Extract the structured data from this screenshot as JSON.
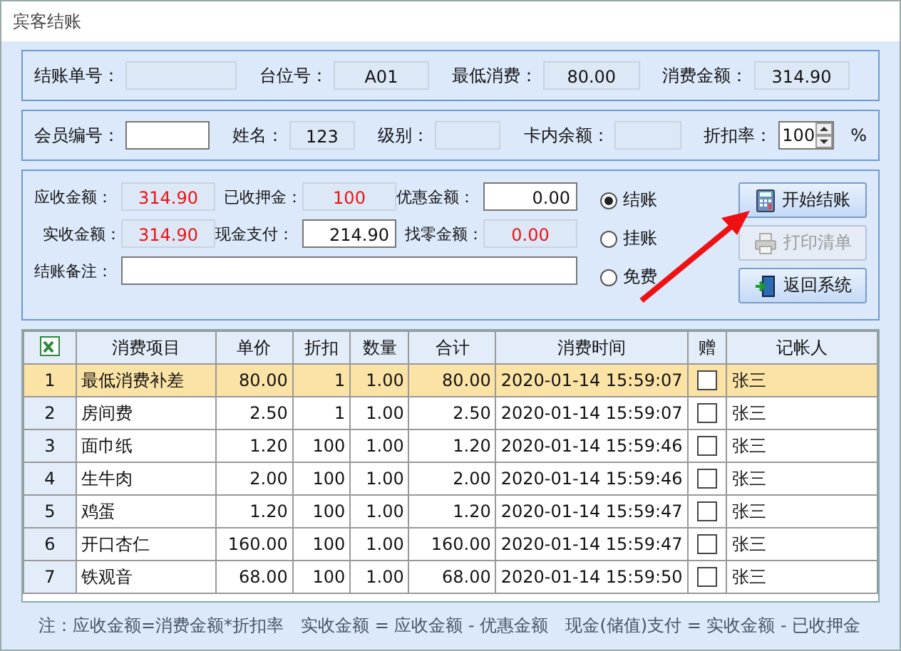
{
  "window": {
    "title": "宾客结账"
  },
  "order_panel": [
    {
      "label": "结账单号："
    },
    {
      "label": "台位号：",
      "value": "A01"
    },
    {
      "label": "最低消费：",
      "value": "80.00"
    },
    {
      "label": "消费金额：",
      "value": "314.90"
    }
  ],
  "member_panel": {
    "fields": [
      {
        "label": "会员编号：",
        "kind": "input"
      },
      {
        "label": "姓名：",
        "value": "123",
        "kind": "readonly"
      },
      {
        "label": "级别：",
        "kind": "readonly"
      },
      {
        "label": "卡内余额：",
        "kind": "readonly"
      }
    ],
    "discount": {
      "label": "折扣率：",
      "value": "100",
      "unit": "%"
    }
  },
  "payment_panel": {
    "fields": [
      {
        "label": "应收金额：",
        "value": "314.90",
        "kind": "alert"
      },
      {
        "label": "已收押金：",
        "value": "100",
        "kind": "alert"
      },
      {
        "label": "优惠金额：",
        "value": "0.00",
        "kind": "input"
      },
      {
        "label": "实收金额：",
        "value": "314.90",
        "kind": "alert"
      },
      {
        "label": "现金支付：",
        "value": "214.90",
        "kind": "input"
      },
      {
        "label": "找零金额：",
        "value": "0.00",
        "kind": "alert"
      }
    ],
    "note_label": "结账备注：",
    "modes": [
      {
        "label": "结账",
        "selected": true
      },
      {
        "label": "挂账",
        "selected": false
      },
      {
        "label": "免费",
        "selected": false
      }
    ],
    "buttons": [
      {
        "label": "开始结账",
        "kind": "calc",
        "disabled": false
      },
      {
        "label": "打印清单",
        "kind": "print",
        "disabled": true
      },
      {
        "label": "返回系统",
        "kind": "exit",
        "disabled": false
      }
    ]
  },
  "table": {
    "columns": [
      "消费项目",
      "单价",
      "折扣",
      "数量",
      "合计",
      "消费时间",
      "赠",
      "记帐人"
    ],
    "rows": [
      {
        "no": "1",
        "item": "最低消费补差",
        "price": "80.00",
        "discount": "1",
        "qty": "1.00",
        "total": "80.00",
        "time": "2020-01-14 15:59:07",
        "gift": false,
        "by": "张三",
        "selected": true
      },
      {
        "no": "2",
        "item": "房间费",
        "price": "2.50",
        "discount": "1",
        "qty": "1.00",
        "total": "2.50",
        "time": "2020-01-14 15:59:07",
        "gift": false,
        "by": "张三",
        "selected": false
      },
      {
        "no": "3",
        "item": "面巾纸",
        "price": "1.20",
        "discount": "100",
        "qty": "1.00",
        "total": "1.20",
        "time": "2020-01-14 15:59:46",
        "gift": false,
        "by": "张三",
        "selected": false
      },
      {
        "no": "4",
        "item": "生牛肉",
        "price": "2.00",
        "discount": "100",
        "qty": "1.00",
        "total": "2.00",
        "time": "2020-01-14 15:59:46",
        "gift": false,
        "by": "张三",
        "selected": false
      },
      {
        "no": "5",
        "item": "鸡蛋",
        "price": "1.20",
        "discount": "100",
        "qty": "1.00",
        "total": "1.20",
        "time": "2020-01-14 15:59:47",
        "gift": false,
        "by": "张三",
        "selected": false
      },
      {
        "no": "6",
        "item": "开口杏仁",
        "price": "160.00",
        "discount": "100",
        "qty": "1.00",
        "total": "160.00",
        "time": "2020-01-14 15:59:47",
        "gift": false,
        "by": "张三",
        "selected": false
      },
      {
        "no": "7",
        "item": "铁观音",
        "price": "68.00",
        "discount": "100",
        "qty": "1.00",
        "total": "68.00",
        "time": "2020-01-14 15:59:50",
        "gift": false,
        "by": "张三",
        "selected": false
      }
    ]
  },
  "footer_note": "注：应收金额=消费金额*折扣率　实收金额 = 应收金额 - 优惠金额　现金(储值)支付 = 实收金额 - 已收押金"
}
